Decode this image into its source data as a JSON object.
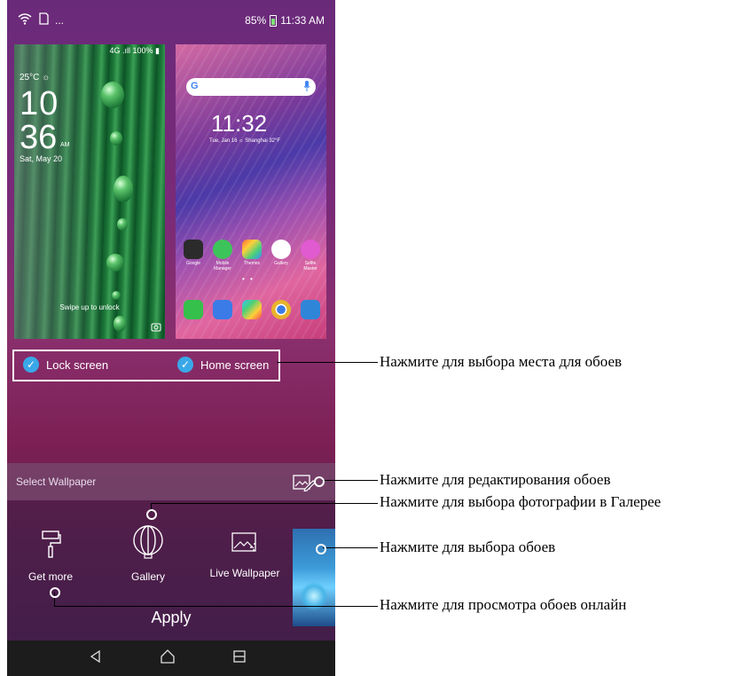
{
  "status_bar": {
    "battery": "85%",
    "time": "11:33 AM",
    "dots": "..."
  },
  "lock_preview": {
    "status": "4G .ıll 100% ▮",
    "temperature": "25°C ☼",
    "hour": "10",
    "minute": "36",
    "ampm": "AM",
    "date": "Sat, May 20",
    "swipe_hint": "Swipe up to unlock"
  },
  "home_preview": {
    "search_g": "G",
    "time": "11:32",
    "date_line": "Tue, Jan 16  ☼ Shanghai  32°F",
    "apps_row1": [
      "Google",
      "Mobile Manager",
      "Themes",
      "Gallery",
      "Selfie Master"
    ],
    "app_colors_row1": [
      "#2b2b2b",
      "#3cc45a",
      "#ff6b3a",
      "#ffffff",
      "#e05ad0"
    ],
    "dock_colors": [
      "#35c04c",
      "#3b7be8",
      "#ffffff",
      "#e8b32c",
      "#2f86d9"
    ]
  },
  "targets": {
    "lock_label": "Lock screen",
    "home_label": "Home screen"
  },
  "select_wallpaper": {
    "label": "Select Wallpaper"
  },
  "options": {
    "get_more": "Get more",
    "gallery": "Gallery",
    "live_wallpaper": "Live Wallpaper"
  },
  "apply_label": "Apply",
  "callouts": {
    "target": "Нажмите для выбора места для обоев",
    "edit": "Нажмите для редактирования обоев",
    "gallery": "Нажмите для выбора фотографии в Галерее",
    "choose": "Нажмите для выбора обоев",
    "online": "Нажмите для просмотра обоев онлайн"
  }
}
